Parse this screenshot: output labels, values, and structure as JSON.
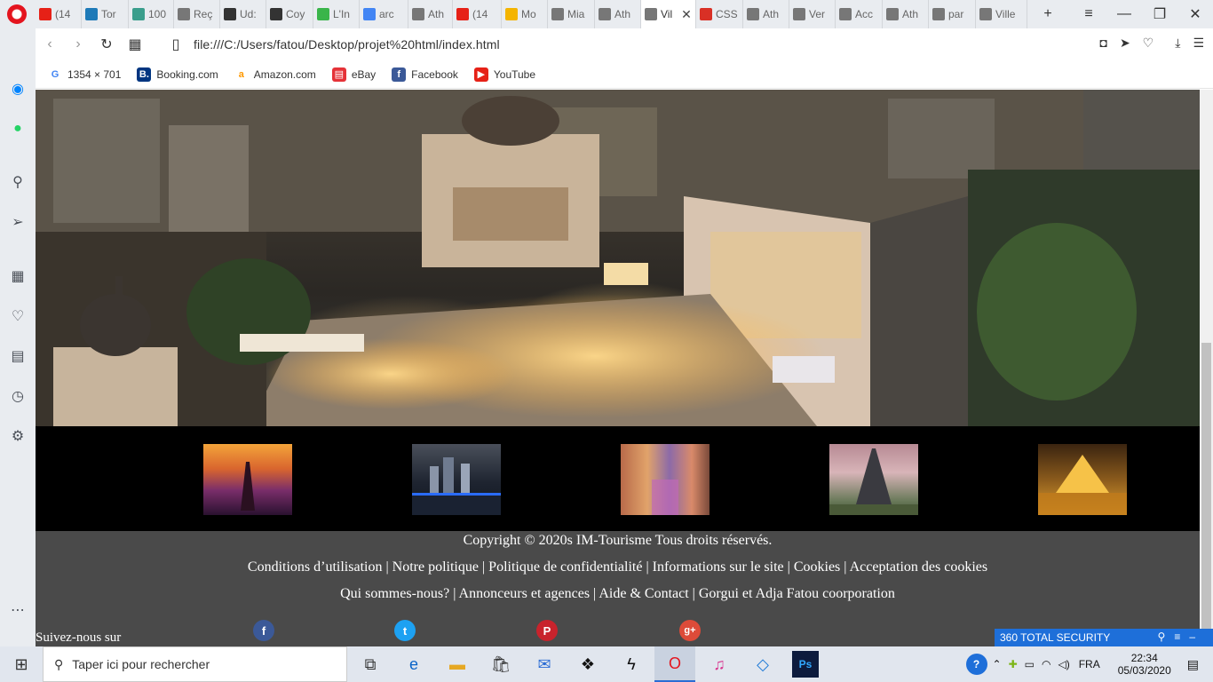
{
  "browser": {
    "tabs": [
      {
        "label": "(14",
        "color": "#e62117"
      },
      {
        "label": "Tor",
        "color": "#1e7ab8"
      },
      {
        "label": "100",
        "color": "#3a9e8c"
      },
      {
        "label": "Reç",
        "color": "#777777"
      },
      {
        "label": "Ud:",
        "color": "#333333"
      },
      {
        "label": "Coy",
        "color": "#333333"
      },
      {
        "label": "L'In",
        "color": "#3ab54a"
      },
      {
        "label": "arc",
        "color": "#4285f4"
      },
      {
        "label": "Ath",
        "color": "#777777"
      },
      {
        "label": "(14",
        "color": "#e62117"
      },
      {
        "label": "Mo",
        "color": "#f4b400"
      },
      {
        "label": "Mia",
        "color": "#777777"
      },
      {
        "label": "Ath",
        "color": "#777777"
      },
      {
        "label": "Vil",
        "color": "#777777"
      },
      {
        "label": "CSS",
        "color": "#d93025"
      },
      {
        "label": "Ath",
        "color": "#777777"
      },
      {
        "label": "Ver",
        "color": "#777777"
      },
      {
        "label": "Acc",
        "color": "#777777"
      },
      {
        "label": "Ath",
        "color": "#777777"
      },
      {
        "label": "par",
        "color": "#777777"
      },
      {
        "label": "Ville",
        "color": "#777777"
      }
    ],
    "url": "file:///C:/Users/fatou/Desktop/projet%20html/index.html",
    "bookmarks": [
      {
        "label": "1354 × 701",
        "icon": "G",
        "color": "#4285f4"
      },
      {
        "label": "Booking.com",
        "icon": "B.",
        "color": "#003580"
      },
      {
        "label": "Amazon.com",
        "icon": "a",
        "color": "#ff9900"
      },
      {
        "label": "eBay",
        "icon": "▤",
        "color": "#e53238"
      },
      {
        "label": "Facebook",
        "icon": "f",
        "color": "#3b5998"
      },
      {
        "label": "YouTube",
        "icon": "▶",
        "color": "#e62117"
      }
    ]
  },
  "page": {
    "copyright": "Copyright © 2020s IM-Tourisme Tous droits réservés.",
    "links_line1": "Conditions d’utilisation | Notre politique | Politique de confidentialité | Informations sur le site | Cookies | Acceptation des cookies",
    "links_line2": "Qui sommes-nous? | Annonceurs et agences | Aide & Contact | Gorgui et Adja Fatou coorporation",
    "follow_label": "Suivez-nous sur",
    "social": [
      {
        "name": "facebook",
        "glyph": "f",
        "color": "#3b5998"
      },
      {
        "name": "twitter",
        "glyph": "t",
        "color": "#1da1f2"
      },
      {
        "name": "pinterest",
        "glyph": "P",
        "color": "#c8232c"
      },
      {
        "name": "google-plus",
        "glyph": "g+",
        "color": "#dd4b39"
      }
    ]
  },
  "tray": {
    "security_label": "360 TOTAL SECURITY",
    "language": "FRA",
    "time": "22:34",
    "date": "05/03/2020"
  },
  "taskbar": {
    "search_placeholder": "Taper ici pour rechercher"
  }
}
